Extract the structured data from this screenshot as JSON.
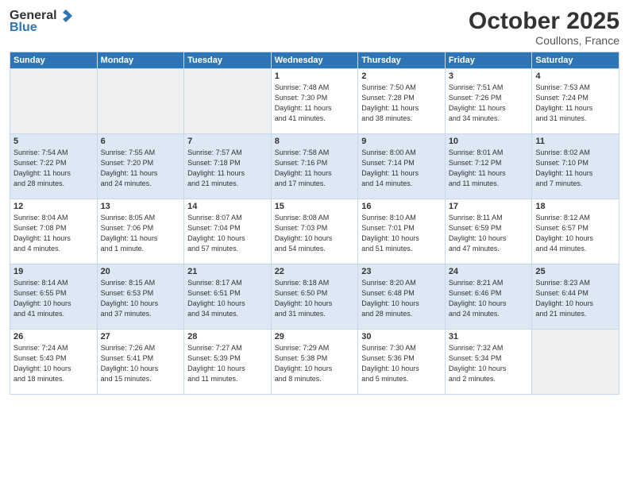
{
  "header": {
    "logo_general": "General",
    "logo_blue": "Blue",
    "month": "October 2025",
    "location": "Coullons, France"
  },
  "weekdays": [
    "Sunday",
    "Monday",
    "Tuesday",
    "Wednesday",
    "Thursday",
    "Friday",
    "Saturday"
  ],
  "weeks": [
    [
      {
        "day": "",
        "info": ""
      },
      {
        "day": "",
        "info": ""
      },
      {
        "day": "",
        "info": ""
      },
      {
        "day": "1",
        "info": "Sunrise: 7:48 AM\nSunset: 7:30 PM\nDaylight: 11 hours\nand 41 minutes."
      },
      {
        "day": "2",
        "info": "Sunrise: 7:50 AM\nSunset: 7:28 PM\nDaylight: 11 hours\nand 38 minutes."
      },
      {
        "day": "3",
        "info": "Sunrise: 7:51 AM\nSunset: 7:26 PM\nDaylight: 11 hours\nand 34 minutes."
      },
      {
        "day": "4",
        "info": "Sunrise: 7:53 AM\nSunset: 7:24 PM\nDaylight: 11 hours\nand 31 minutes."
      }
    ],
    [
      {
        "day": "5",
        "info": "Sunrise: 7:54 AM\nSunset: 7:22 PM\nDaylight: 11 hours\nand 28 minutes."
      },
      {
        "day": "6",
        "info": "Sunrise: 7:55 AM\nSunset: 7:20 PM\nDaylight: 11 hours\nand 24 minutes."
      },
      {
        "day": "7",
        "info": "Sunrise: 7:57 AM\nSunset: 7:18 PM\nDaylight: 11 hours\nand 21 minutes."
      },
      {
        "day": "8",
        "info": "Sunrise: 7:58 AM\nSunset: 7:16 PM\nDaylight: 11 hours\nand 17 minutes."
      },
      {
        "day": "9",
        "info": "Sunrise: 8:00 AM\nSunset: 7:14 PM\nDaylight: 11 hours\nand 14 minutes."
      },
      {
        "day": "10",
        "info": "Sunrise: 8:01 AM\nSunset: 7:12 PM\nDaylight: 11 hours\nand 11 minutes."
      },
      {
        "day": "11",
        "info": "Sunrise: 8:02 AM\nSunset: 7:10 PM\nDaylight: 11 hours\nand 7 minutes."
      }
    ],
    [
      {
        "day": "12",
        "info": "Sunrise: 8:04 AM\nSunset: 7:08 PM\nDaylight: 11 hours\nand 4 minutes."
      },
      {
        "day": "13",
        "info": "Sunrise: 8:05 AM\nSunset: 7:06 PM\nDaylight: 11 hours\nand 1 minute."
      },
      {
        "day": "14",
        "info": "Sunrise: 8:07 AM\nSunset: 7:04 PM\nDaylight: 10 hours\nand 57 minutes."
      },
      {
        "day": "15",
        "info": "Sunrise: 8:08 AM\nSunset: 7:03 PM\nDaylight: 10 hours\nand 54 minutes."
      },
      {
        "day": "16",
        "info": "Sunrise: 8:10 AM\nSunset: 7:01 PM\nDaylight: 10 hours\nand 51 minutes."
      },
      {
        "day": "17",
        "info": "Sunrise: 8:11 AM\nSunset: 6:59 PM\nDaylight: 10 hours\nand 47 minutes."
      },
      {
        "day": "18",
        "info": "Sunrise: 8:12 AM\nSunset: 6:57 PM\nDaylight: 10 hours\nand 44 minutes."
      }
    ],
    [
      {
        "day": "19",
        "info": "Sunrise: 8:14 AM\nSunset: 6:55 PM\nDaylight: 10 hours\nand 41 minutes."
      },
      {
        "day": "20",
        "info": "Sunrise: 8:15 AM\nSunset: 6:53 PM\nDaylight: 10 hours\nand 37 minutes."
      },
      {
        "day": "21",
        "info": "Sunrise: 8:17 AM\nSunset: 6:51 PM\nDaylight: 10 hours\nand 34 minutes."
      },
      {
        "day": "22",
        "info": "Sunrise: 8:18 AM\nSunset: 6:50 PM\nDaylight: 10 hours\nand 31 minutes."
      },
      {
        "day": "23",
        "info": "Sunrise: 8:20 AM\nSunset: 6:48 PM\nDaylight: 10 hours\nand 28 minutes."
      },
      {
        "day": "24",
        "info": "Sunrise: 8:21 AM\nSunset: 6:46 PM\nDaylight: 10 hours\nand 24 minutes."
      },
      {
        "day": "25",
        "info": "Sunrise: 8:23 AM\nSunset: 6:44 PM\nDaylight: 10 hours\nand 21 minutes."
      }
    ],
    [
      {
        "day": "26",
        "info": "Sunrise: 7:24 AM\nSunset: 5:43 PM\nDaylight: 10 hours\nand 18 minutes."
      },
      {
        "day": "27",
        "info": "Sunrise: 7:26 AM\nSunset: 5:41 PM\nDaylight: 10 hours\nand 15 minutes."
      },
      {
        "day": "28",
        "info": "Sunrise: 7:27 AM\nSunset: 5:39 PM\nDaylight: 10 hours\nand 11 minutes."
      },
      {
        "day": "29",
        "info": "Sunrise: 7:29 AM\nSunset: 5:38 PM\nDaylight: 10 hours\nand 8 minutes."
      },
      {
        "day": "30",
        "info": "Sunrise: 7:30 AM\nSunset: 5:36 PM\nDaylight: 10 hours\nand 5 minutes."
      },
      {
        "day": "31",
        "info": "Sunrise: 7:32 AM\nSunset: 5:34 PM\nDaylight: 10 hours\nand 2 minutes."
      },
      {
        "day": "",
        "info": ""
      }
    ]
  ]
}
